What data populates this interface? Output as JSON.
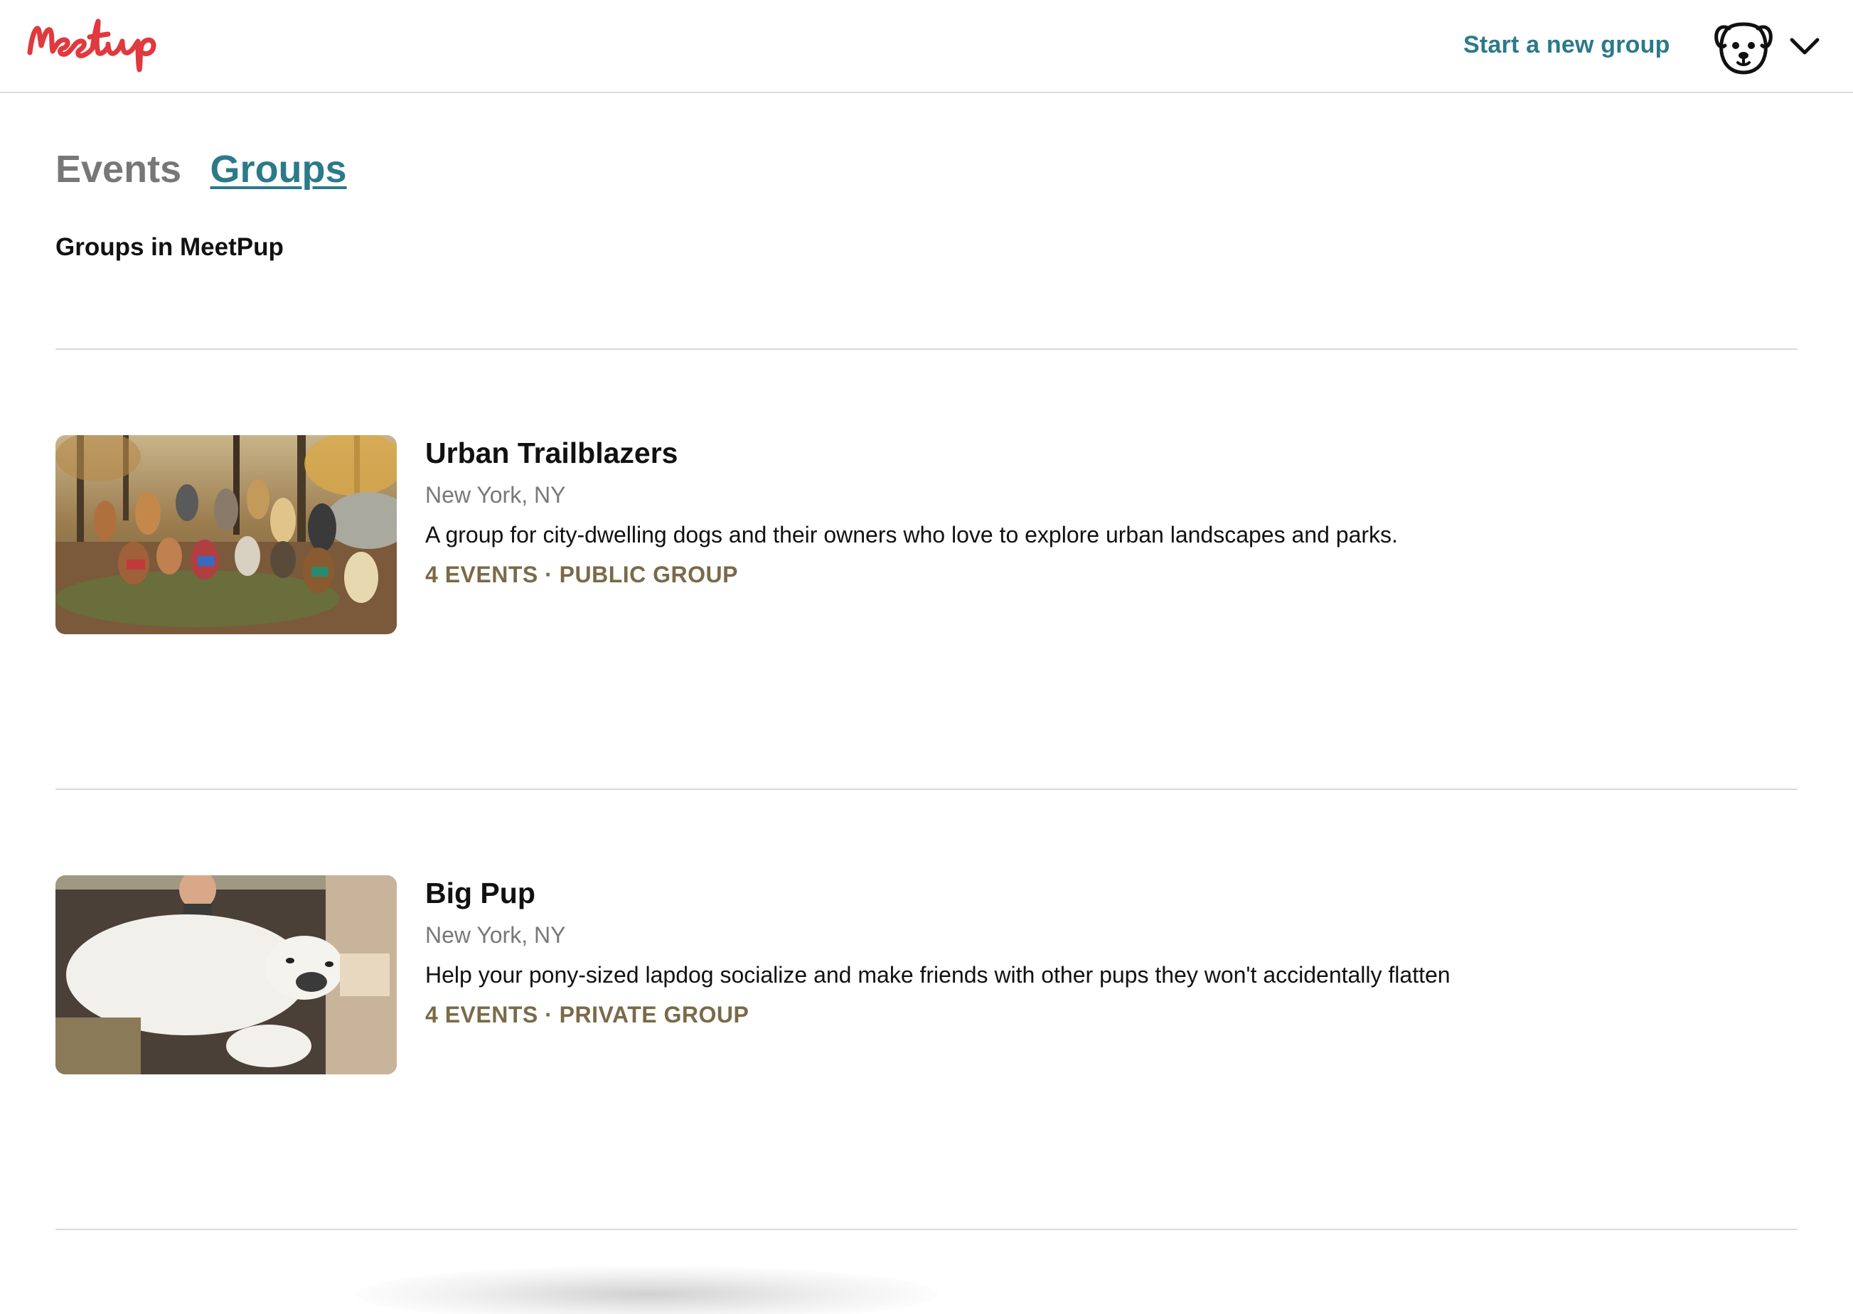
{
  "header": {
    "logo_text": "Meetup",
    "start_group_label": "Start a new group",
    "profile_icon": "dog-face-icon",
    "menu_icon": "chevron-down-icon"
  },
  "tabs": [
    {
      "label": "Events",
      "active": false
    },
    {
      "label": "Groups",
      "active": true
    }
  ],
  "section_title": "Groups in MeetPup",
  "groups": [
    {
      "name": "Urban Trailblazers",
      "location": "New York, NY",
      "description": "A group for city-dwelling dogs and their owners who love to explore urban landscapes and parks.",
      "meta": "4 EVENTS · PUBLIC GROUP",
      "image": "dogs-pack-in-autumn-woods-photo"
    },
    {
      "name": "Big Pup",
      "location": "New York, NY",
      "description": "Help your pony-sized lapdog socialize and make friends with other pups they won't accidentally flatten",
      "meta": "4 EVENTS · PRIVATE GROUP",
      "image": "large-white-dog-on-couch-photo"
    }
  ],
  "colors": {
    "brand_red": "#e0393e",
    "link_teal": "#2b7a89",
    "meta_brown": "#7a6a48",
    "muted_gray": "#787878"
  }
}
